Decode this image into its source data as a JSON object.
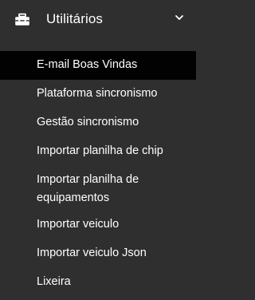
{
  "menu": {
    "header": {
      "title": "Utilitários",
      "icon": "toolbox-icon",
      "chevron": "chevron-down-icon"
    },
    "items": [
      {
        "label": "E-mail Boas Vindas",
        "active": true
      },
      {
        "label": "Plataforma sincronismo",
        "active": false
      },
      {
        "label": "Gestão sincronismo",
        "active": false
      },
      {
        "label": "Importar planilha de chip",
        "active": false
      },
      {
        "label": "Importar planilha de equipamentos",
        "active": false
      },
      {
        "label": "Importar veiculo",
        "active": false
      },
      {
        "label": "Importar veiculo Json",
        "active": false
      },
      {
        "label": "Lixeira",
        "active": false
      }
    ]
  },
  "colors": {
    "background": "#2f2f2f",
    "active_background": "#020202",
    "text": "#ffffff"
  }
}
